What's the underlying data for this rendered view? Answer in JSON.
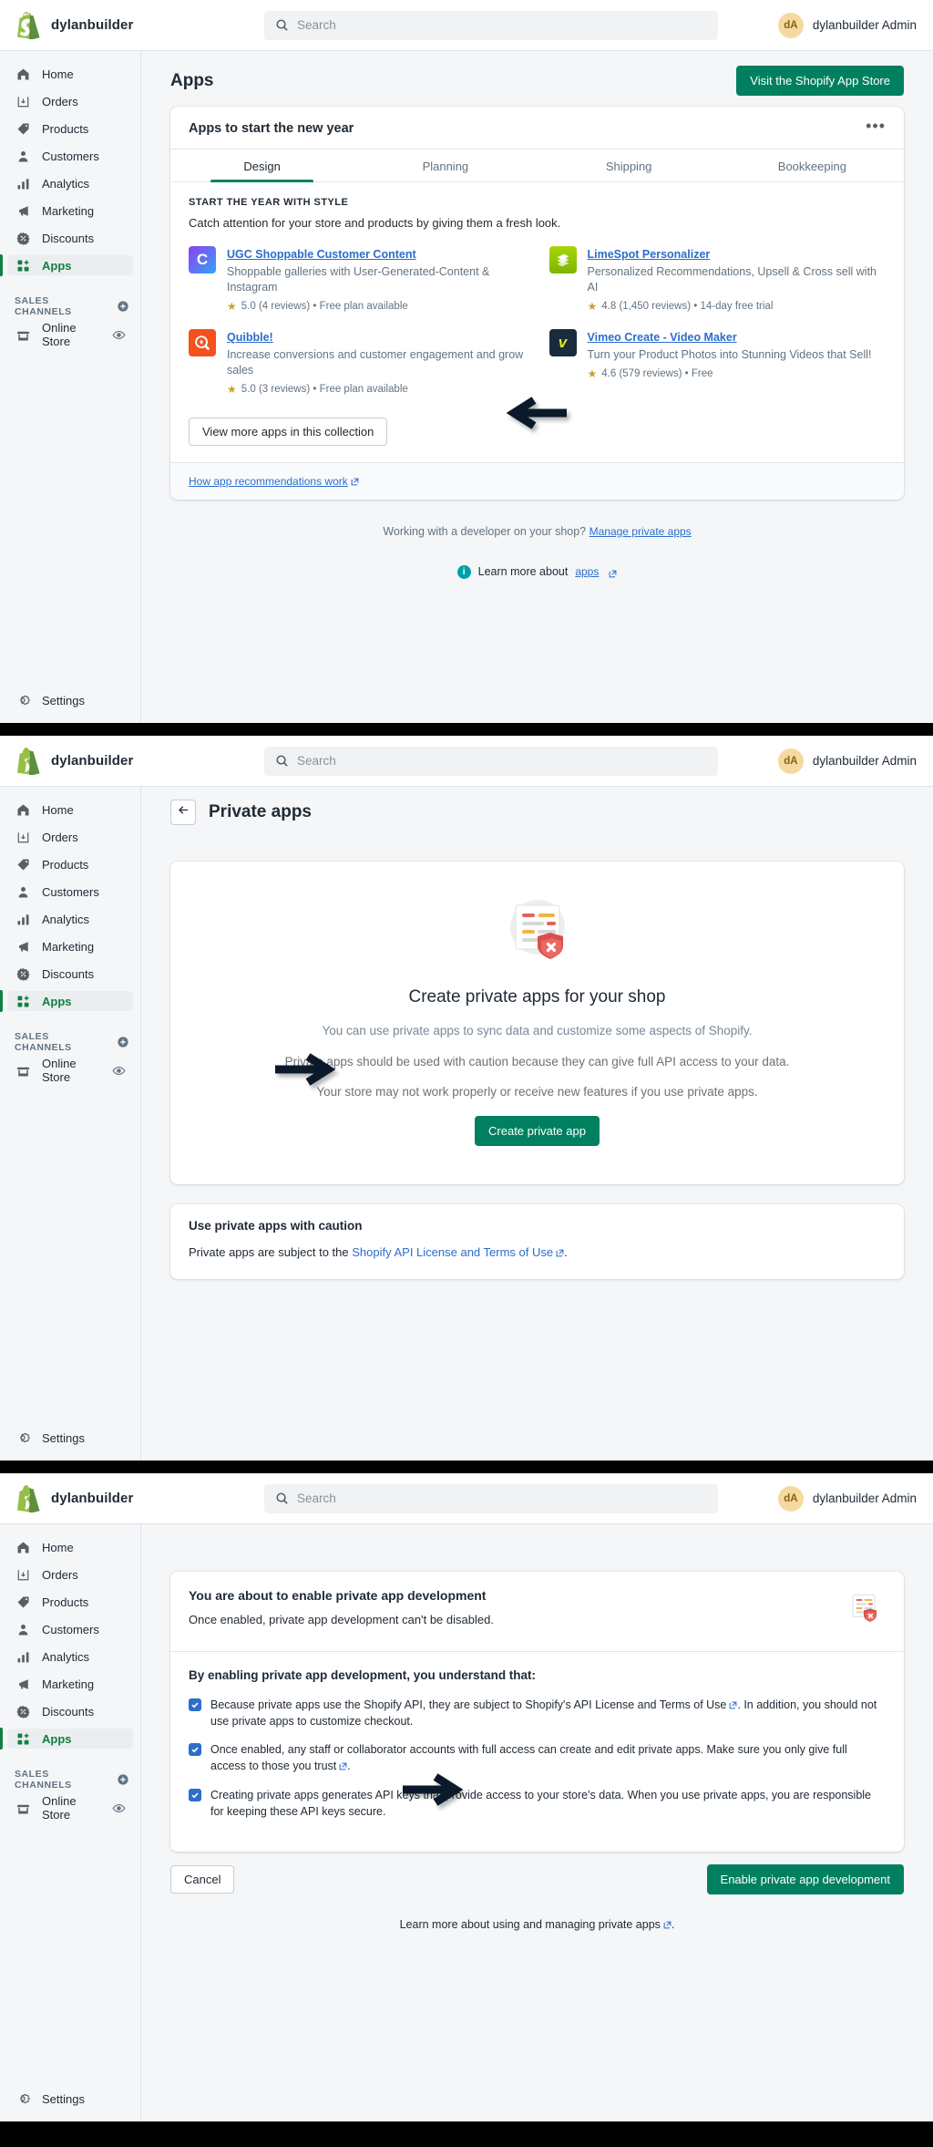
{
  "topbar": {
    "brand_name": "dylanbuilder",
    "logo_icon": "shopify-bag-logo",
    "search_placeholder": "Search",
    "search_value": "",
    "search_icon": "search-icon",
    "avatar_initials": "dA",
    "user_name": "dylanbuilder Admin"
  },
  "sidebar": {
    "items": [
      {
        "label": "Home",
        "icon": "home-icon"
      },
      {
        "label": "Orders",
        "icon": "orders-inbox-icon"
      },
      {
        "label": "Products",
        "icon": "tag-icon"
      },
      {
        "label": "Customers",
        "icon": "person-icon"
      },
      {
        "label": "Analytics",
        "icon": "bar-chart-icon"
      },
      {
        "label": "Marketing",
        "icon": "megaphone-icon"
      },
      {
        "label": "Discounts",
        "icon": "discount-badge-icon"
      },
      {
        "label": "Apps",
        "icon": "apps-grid-icon"
      }
    ],
    "section_title": "SALES CHANNELS",
    "section_add_icon": "plus-circle-icon",
    "channels": [
      {
        "label": "Online Store",
        "icon": "storefront-icon",
        "trailing_icon": "eye-icon"
      }
    ],
    "settings": {
      "label": "Settings",
      "icon": "gear-icon"
    },
    "active_item": "Apps",
    "accent_color": "#108043"
  },
  "panel1": {
    "page_title": "Apps",
    "app_store_button": "Visit the Shopify App Store",
    "card": {
      "title": "Apps to start the new year",
      "overflow_icon": "more-horizontal-icon",
      "tabs": [
        {
          "label": "Design",
          "active": true
        },
        {
          "label": "Planning",
          "active": false
        },
        {
          "label": "Shipping",
          "active": false
        },
        {
          "label": "Bookkeeping",
          "active": false
        }
      ],
      "collection_kicker": "START THE YEAR WITH STYLE",
      "collection_desc": "Catch attention for your store and products by giving them a fresh look.",
      "apps": [
        {
          "name": "UGC Shoppable Customer Content",
          "desc": "Shoppable galleries with User-Generated-Content & Instagram",
          "rating": "5.0",
          "meta": "5.0 (4 reviews) • Free plan available",
          "icon_letter": "C",
          "icon_class": "ic-ugc"
        },
        {
          "name": "LimeSpot Personalizer",
          "desc": "Personalized Recommendations, Upsell & Cross sell with AI",
          "rating": "4.8",
          "meta": "4.8 (1,450 reviews) • 14-day free trial",
          "icon_letter": "",
          "icon_class": "ic-limespot"
        },
        {
          "name": "Quibble!",
          "desc": "Increase conversions and customer engagement and grow sales",
          "rating": "5.0",
          "meta": "5.0 (3 reviews) • Free plan available",
          "icon_letter": "",
          "icon_class": "ic-quibble"
        },
        {
          "name": "Vimeo Create - Video Maker",
          "desc": "Turn your Product Photos into Stunning Videos that Sell!",
          "rating": "4.6",
          "meta": "4.6 (579 reviews) • Free",
          "icon_letter": "v",
          "icon_class": "ic-vimeo"
        }
      ],
      "view_more_button": "View more apps in this collection",
      "footer_link": "How app recommendations work",
      "footer_link_icon": "external-link-icon"
    },
    "developer_note_text": "Working with a developer on your shop? ",
    "developer_note_link": "Manage private apps",
    "learn_more_prefix": "Learn more about ",
    "learn_more_link": "apps",
    "learn_more_icon": "info-circle-icon",
    "arrow_icon": "arrow-left-annotation"
  },
  "panel2": {
    "back_icon": "arrow-left-icon",
    "page_title": "Private apps",
    "illustration": "private-app-shield-document-illustration",
    "empty_title": "Create private apps for your shop",
    "empty_paragraphs": [
      "You can use private apps to sync data and customize some aspects of Shopify.",
      "Private apps should be used with caution because they can give full API access to your data.",
      "Your store may not work properly or receive new features if you use private apps."
    ],
    "create_button": "Create private app",
    "caution_title": "Use private apps with caution",
    "caution_text_prefix": "Private apps are subject to the ",
    "caution_link": "Shopify API License and Terms of Use",
    "caution_link_icon": "external-link-icon",
    "caution_text_suffix": ".",
    "arrow_icon": "arrow-right-annotation"
  },
  "panel3": {
    "confirm_title": "You are about to enable private app development",
    "confirm_subtitle": "Once enabled, private app development can't be disabled.",
    "illustration": "private-app-shield-document-illustration",
    "list_heading": "By enabling private app development, you understand that:",
    "items": [
      {
        "checked": true,
        "prefix": "Because private apps use the Shopify API, they are subject to ",
        "link": "Shopify's API License and Terms of Use",
        "link_icon": "external-link-icon",
        "suffix": ". In addition, you should not use private apps to customize checkout."
      },
      {
        "checked": true,
        "prefix": "Once enabled, any staff or collaborator accounts with full access can create and edit private apps. ",
        "link": "Make sure you only give full access to those you trust",
        "link_icon": "external-link-icon",
        "suffix": "."
      },
      {
        "checked": true,
        "prefix": "Creating private apps generates API keys that provide access to your store's data. When you use private apps, you are responsible for keeping these API keys secure.",
        "link": "",
        "link_icon": "",
        "suffix": ""
      }
    ],
    "cancel_button": "Cancel",
    "enable_button": "Enable private app development",
    "footer_prefix": "Learn more about ",
    "footer_link": "using and managing private apps",
    "footer_link_icon": "external-link-icon",
    "footer_suffix": ".",
    "arrow_icon": "arrow-right-annotation"
  },
  "colors": {
    "primary_green": "#008060",
    "active_green": "#108043",
    "link_blue": "#2c6ecb",
    "checkbox_blue": "#2c6ecb",
    "page_bg": "#f4f6f8",
    "star_gold": "#c9a227"
  }
}
